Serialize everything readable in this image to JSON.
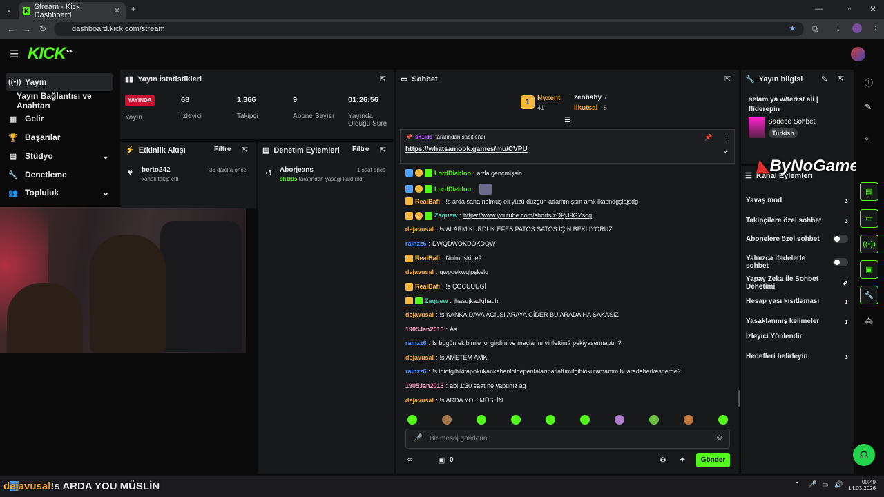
{
  "browser": {
    "tab_title": "Stream - Kick Dashboard",
    "url": "dashboard.kick.com/stream"
  },
  "brand": {
    "logo": "KICK",
    "beta": "BETA"
  },
  "sidebar": {
    "items": [
      {
        "label": "Yayın"
      },
      {
        "label": "Yayın Bağlantısı ve Anahtarı"
      },
      {
        "label": "Gelir"
      },
      {
        "label": "Başarılar"
      },
      {
        "label": "Stüdyo"
      },
      {
        "label": "Denetleme"
      },
      {
        "label": "Topluluk"
      }
    ]
  },
  "stats": {
    "title": "Yayın İstatistikleri",
    "live": "YAYINDA",
    "live_label": "Yayın",
    "viewers": "68",
    "viewers_label": "İzleyici",
    "followers": "1.366",
    "followers_label": "Takipçi",
    "subs": "9",
    "subs_label": "Abone Sayısı",
    "duration": "01:26:56",
    "duration_label": "Yayında Olduğu Süre"
  },
  "activity": {
    "title": "Etkinlik Akışı",
    "filter": "Filtre",
    "user": "berto242",
    "text": "kanalı takip etti",
    "time": "33 dakika önce"
  },
  "moderation": {
    "title": "Denetim Eylemleri",
    "filter": "Filtre",
    "user": "Aborjeans",
    "actor": "sh1lds",
    "text": "tarafından yasağı kaldırıldı",
    "time": "1 saat önce"
  },
  "chat": {
    "title": "Sohbet",
    "top1_name": "Nyxent",
    "top1_count": "41",
    "top2_name": "zeobaby",
    "top2_count": "7",
    "top3_name": "likutsal",
    "top3_count": "5",
    "pinned_by": "sh1lds",
    "pinned_suffix": "tarafından sabitlendi",
    "pinned_link": "https://whatsamook.games/mu/CVPU",
    "messages": [
      {
        "user": "LordDiabloo",
        "text": "arda gençmişsin",
        "color": "#53fc18"
      },
      {
        "user": "LordDiabloo",
        "text": "",
        "color": "#53fc18"
      },
      {
        "user": "RealBafi",
        "text": "!s arda sana nolmuş eli yüzü düzgün adammışsın amk lkasndgşlajsdg",
        "color": "#f6b73c"
      },
      {
        "user": "Zaquew",
        "text": "https://www.youtube.com/shorts/zQPjJ9GYsog",
        "color": "#43d6b5"
      },
      {
        "user": "dejavusal",
        "text": "!s ALARM KURDUK EFES PATOS SATOS İÇİN BEKLİYORUZ",
        "color": "#f5a623"
      },
      {
        "user": "rainzz6",
        "text": "DWQDWOKDOKDQW",
        "color": "#4a90ff"
      },
      {
        "user": "RealBafi",
        "text": "Nolmuşkine?",
        "color": "#f6b73c"
      },
      {
        "user": "dejavusal",
        "text": "qwpoekwqlpşkelq",
        "color": "#f5a623"
      },
      {
        "user": "RealBafi",
        "text": "!s ÇOCUUUGİ",
        "color": "#f6b73c"
      },
      {
        "user": "Zaquew",
        "text": "jhasdjkadkjhadh",
        "color": "#43d6b5"
      },
      {
        "user": "dejavusal",
        "text": "!s KANKA DAVA AÇILSI ARAYA GİDER BU ARADA HA ŞAKASIZ",
        "color": "#f5a623"
      },
      {
        "user": "1905Jan2013",
        "text": "As",
        "color": "#ff9ec7"
      },
      {
        "user": "rainzz6",
        "text": "!s bugün ekibimle lol girdim ve maçlarını vinlettim? pekiyasennaptın?",
        "color": "#4a90ff"
      },
      {
        "user": "dejavusal",
        "text": "!s AMETEM AMK",
        "color": "#f5a623"
      },
      {
        "user": "rainzz6",
        "text": "!s idiotgibikitapokukankabenloldepentalarıpatlattımitgibiokutamammıbuaradaherkesnerde?",
        "color": "#4a90ff"
      },
      {
        "user": "1905Jan2013",
        "text": "abi 1:30 saat ne yaptınız aq",
        "color": "#ff9ec7"
      },
      {
        "user": "dejavusal",
        "text": "!s ARDA YOU MÜSLİN",
        "color": "#f5a623"
      }
    ],
    "placeholder": "Bir mesaj gönderin",
    "points": "0",
    "send": "Gönder"
  },
  "info": {
    "title": "Yayın bilgisi",
    "stream_title": "selam ya w/terrst ali | !liderepin",
    "category": "Sadece Sohbet",
    "language": "Turkish"
  },
  "channel_actions": {
    "title": "Kanal Eylemleri",
    "items": [
      {
        "label": "Yavaş mod",
        "control": "chevron"
      },
      {
        "label": "Takipçilere özel sohbet",
        "control": "chevron"
      },
      {
        "label": "Abonelere özel sohbet",
        "control": "toggle"
      },
      {
        "label": "Yalnızca ifadelerle sohbet",
        "control": "toggle"
      },
      {
        "label": "Yapay Zeka ile Sohbet Denetimi",
        "control": "link"
      },
      {
        "label": "Hesap yaşı kısıtlaması",
        "control": "chevron"
      },
      {
        "label": "Yasaklanmış kelimeler",
        "control": "chevron"
      },
      {
        "label": "İzleyici Yönlendir",
        "control": "none"
      },
      {
        "label": "Hedefleri belirleyin",
        "control": "chevron"
      }
    ]
  },
  "watermark": "ByNoGame",
  "overlay": {
    "user": "dejavusal",
    "text": "!s ARDA YOU MÜSLİN"
  },
  "taskbar": {
    "time": "00:49",
    "date": "14.03.2026"
  }
}
